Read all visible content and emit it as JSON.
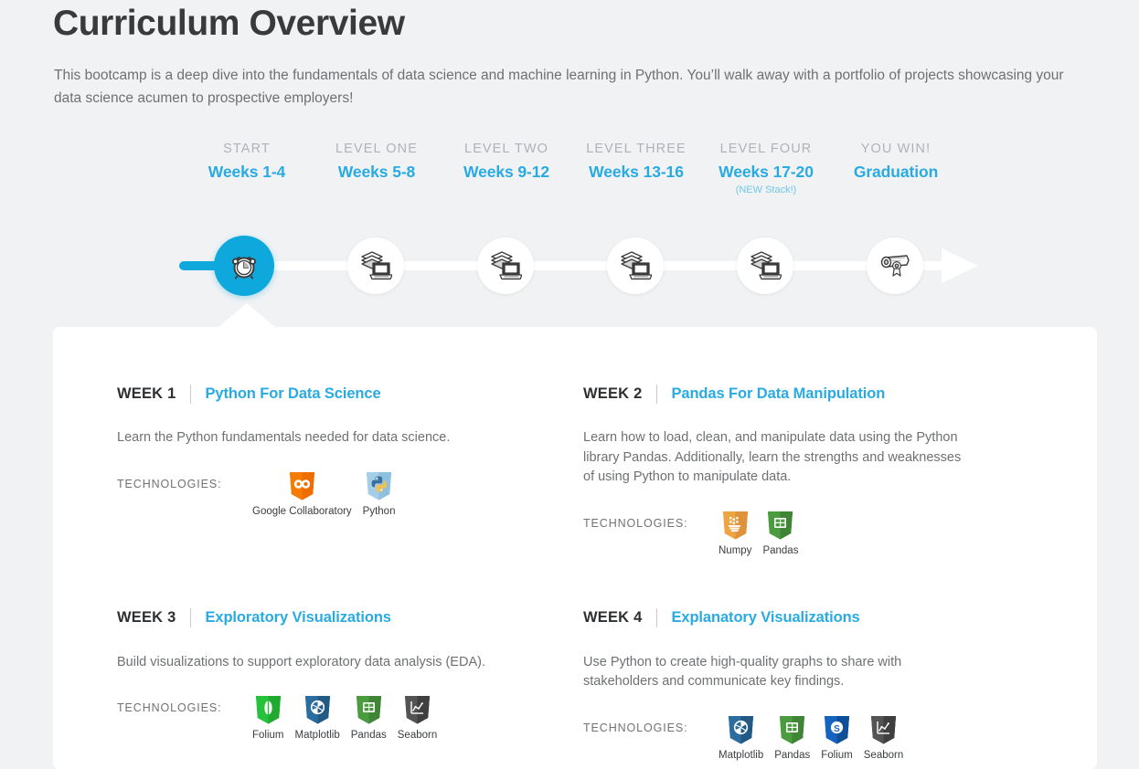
{
  "header": {
    "title": "Curriculum Overview",
    "subtitle": "This bootcamp is a deep dive into the fundamentals of data science and machine learning in Python. You’ll walk away with a portfolio of projects showcasing your data science acumen to prospective employers!"
  },
  "colors": {
    "accent": "#29abe2",
    "accent_node": "#0fa8dd",
    "background": "#f1f2f4",
    "card": "#ffffff",
    "heading": "#3a3a3c",
    "body_text": "#6e7072",
    "muted_label": "#b0b2b5"
  },
  "timeline": {
    "active_index": 0,
    "end_arrow": "arrow-right",
    "stages": [
      {
        "level": "START",
        "weeks": "Weeks 1-4",
        "note": "",
        "icon": "alarm-clock-icon",
        "active": true
      },
      {
        "level": "LEVEL ONE",
        "weeks": "Weeks 5-8",
        "note": "",
        "icon": "books-laptop-icon",
        "active": false
      },
      {
        "level": "LEVEL TWO",
        "weeks": "Weeks 9-12",
        "note": "",
        "icon": "books-laptop-icon",
        "active": false
      },
      {
        "level": "LEVEL THREE",
        "weeks": "Weeks 13-16",
        "note": "",
        "icon": "books-laptop-icon",
        "active": false
      },
      {
        "level": "LEVEL FOUR",
        "weeks": "Weeks 17-20",
        "note": "(NEW Stack!)",
        "icon": "books-laptop-icon",
        "active": false
      },
      {
        "level": "YOU WIN!",
        "weeks": "Graduation",
        "note": "",
        "icon": "diploma-icon",
        "active": false
      }
    ]
  },
  "card": {
    "tech_label": "TECHNOLOGIES:",
    "weeks": [
      {
        "number": "WEEK 1",
        "title": "Python For Data Science",
        "description": "Learn the Python fundamentals needed for data science.",
        "technologies": [
          {
            "name": "Google Collaboratory",
            "icon": "google-colab-shield-icon",
            "color": "#f57c00",
            "color2": "#ef6c00"
          },
          {
            "name": "Python",
            "icon": "python-shield-icon",
            "color": "#a4cde8",
            "color2": "#8fc0e0"
          }
        ]
      },
      {
        "number": "WEEK 2",
        "title": "Pandas For Data Manipulation",
        "description": "Learn how to load, clean, and manipulate data using the Python library Pandas. Additionally, learn the strengths and weaknesses of using Python to manipulate data.",
        "technologies": [
          {
            "name": "Numpy",
            "icon": "numpy-shield-icon",
            "color": "#eda543",
            "color2": "#e0923a"
          },
          {
            "name": "Pandas",
            "icon": "pandas-shield-icon",
            "color": "#4b9b3f",
            "color2": "#3f8535"
          }
        ]
      },
      {
        "number": "WEEK 3",
        "title": "Exploratory Visualizations",
        "description": "Build visualizations to support exploratory data analysis (EDA).",
        "technologies": [
          {
            "name": "Folium",
            "icon": "folium-shield-icon",
            "color": "#27c23c",
            "color2": "#1faa31"
          },
          {
            "name": "Matplotlib",
            "icon": "matplotlib-shield-icon",
            "color": "#2a6d9e",
            "color2": "#215a85"
          },
          {
            "name": "Pandas",
            "icon": "pandas-shield-icon",
            "color": "#4b9b3f",
            "color2": "#3f8535"
          },
          {
            "name": "Seaborn",
            "icon": "seaborn-shield-icon",
            "color": "#545454",
            "color2": "#3f3f3f"
          }
        ]
      },
      {
        "number": "WEEK 4",
        "title": "Explanatory Visualizations",
        "description": "Use Python to create high-quality graphs to share with stakeholders and communicate key findings.",
        "technologies": [
          {
            "name": "Matplotlib",
            "icon": "matplotlib-shield-icon",
            "color": "#2a6d9e",
            "color2": "#215a85"
          },
          {
            "name": "Pandas",
            "icon": "pandas-shield-icon",
            "color": "#4b9b3f",
            "color2": "#3f8535"
          },
          {
            "name": "Folium",
            "icon": "folium-blue-shield-icon",
            "color": "#1565c0",
            "color2": "#0f4e99"
          },
          {
            "name": "Seaborn",
            "icon": "seaborn-shield-icon",
            "color": "#545454",
            "color2": "#3f3f3f"
          }
        ]
      }
    ]
  }
}
